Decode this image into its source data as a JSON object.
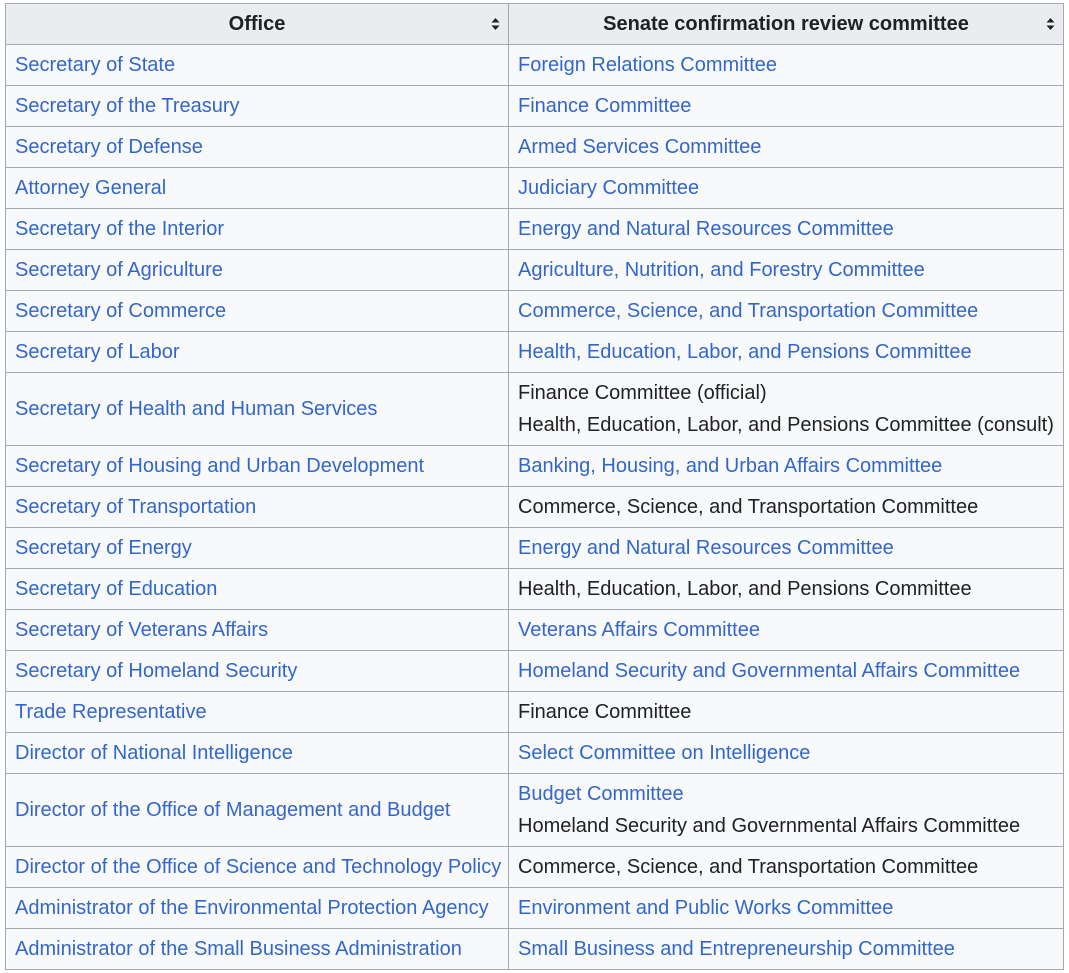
{
  "header": {
    "office_label": "Office",
    "committee_label": "Senate confirmation review committee",
    "sort_icon": "sort-updown-icon"
  },
  "colors": {
    "link": "#3366cc",
    "text": "#202122",
    "header_bg": "#eaecf0",
    "cell_bg": "#f8f9fa",
    "border": "#a2a9b1"
  },
  "rows": [
    {
      "office": "Secretary of State",
      "committees": [
        {
          "text": "Foreign Relations Committee",
          "link": true
        }
      ]
    },
    {
      "office": "Secretary of the Treasury",
      "committees": [
        {
          "text": "Finance Committee",
          "link": true
        }
      ]
    },
    {
      "office": "Secretary of Defense",
      "committees": [
        {
          "text": "Armed Services Committee",
          "link": true
        }
      ]
    },
    {
      "office": "Attorney General",
      "committees": [
        {
          "text": "Judiciary Committee",
          "link": true
        }
      ]
    },
    {
      "office": "Secretary of the Interior",
      "committees": [
        {
          "text": "Energy and Natural Resources Committee",
          "link": true
        }
      ]
    },
    {
      "office": "Secretary of Agriculture",
      "committees": [
        {
          "text": "Agriculture, Nutrition, and Forestry Committee",
          "link": true
        }
      ]
    },
    {
      "office": "Secretary of Commerce",
      "committees": [
        {
          "text": "Commerce, Science, and Transportation Committee",
          "link": true
        }
      ]
    },
    {
      "office": "Secretary of Labor",
      "committees": [
        {
          "text": "Health, Education, Labor, and Pensions Committee",
          "link": true
        }
      ]
    },
    {
      "office": "Secretary of Health and Human Services",
      "committees": [
        {
          "text": "Finance Committee (official)",
          "link": false
        },
        {
          "text": "Health, Education, Labor, and Pensions Committee (consult)",
          "link": false
        }
      ]
    },
    {
      "office": "Secretary of Housing and Urban Development",
      "committees": [
        {
          "text": "Banking, Housing, and Urban Affairs Committee",
          "link": true
        }
      ]
    },
    {
      "office": "Secretary of Transportation",
      "committees": [
        {
          "text": "Commerce, Science, and Transportation Committee",
          "link": false
        }
      ]
    },
    {
      "office": "Secretary of Energy",
      "committees": [
        {
          "text": "Energy and Natural Resources Committee",
          "link": true
        }
      ]
    },
    {
      "office": "Secretary of Education",
      "committees": [
        {
          "text": "Health, Education, Labor, and Pensions Committee",
          "link": false
        }
      ]
    },
    {
      "office": "Secretary of Veterans Affairs",
      "committees": [
        {
          "text": "Veterans Affairs Committee",
          "link": true
        }
      ]
    },
    {
      "office": "Secretary of Homeland Security",
      "committees": [
        {
          "text": "Homeland Security and Governmental Affairs Committee",
          "link": true
        }
      ]
    },
    {
      "office": "Trade Representative",
      "committees": [
        {
          "text": "Finance Committee",
          "link": false
        }
      ]
    },
    {
      "office": "Director of National Intelligence",
      "committees": [
        {
          "text": "Select Committee on Intelligence",
          "link": true
        }
      ]
    },
    {
      "office": "Director of the Office of Management and Budget",
      "committees": [
        {
          "text": "Budget Committee",
          "link": true
        },
        {
          "text": "Homeland Security and Governmental Affairs Committee",
          "link": false
        }
      ]
    },
    {
      "office": "Director of the Office of Science and Technology Policy",
      "committees": [
        {
          "text": "Commerce, Science, and Transportation Committee",
          "link": false
        }
      ]
    },
    {
      "office": "Administrator of the Environmental Protection Agency",
      "committees": [
        {
          "text": "Environment and Public Works Committee",
          "link": true
        }
      ]
    },
    {
      "office": "Administrator of the Small Business Administration",
      "committees": [
        {
          "text": "Small Business and Entrepreneurship Committee",
          "link": true
        }
      ]
    }
  ]
}
